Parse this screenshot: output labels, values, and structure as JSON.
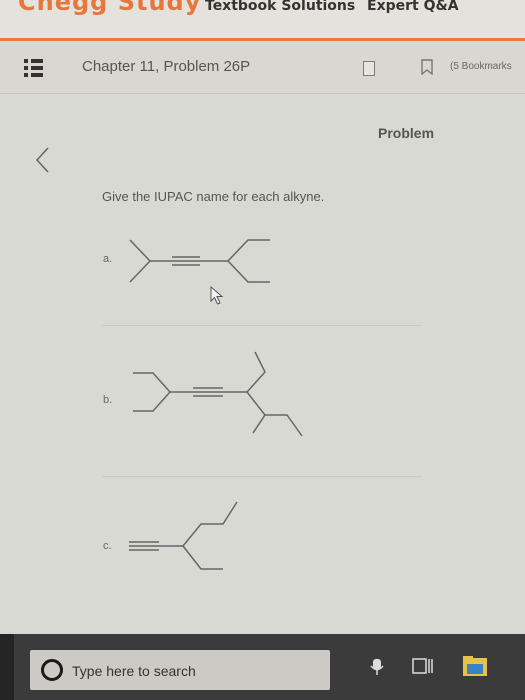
{
  "topnav": {
    "brand": "Chegg Study",
    "links": [
      "Textbook Solutions",
      "Expert Q&A"
    ]
  },
  "header": {
    "chapter_title": "Chapter 11, Problem 26P",
    "bookmarks_label": "(5 Bookmarks"
  },
  "main": {
    "problem_label": "Problem",
    "question": "Give the IUPAC name for each alkyne.",
    "parts": [
      "a.",
      "b.",
      "c."
    ]
  },
  "taskbar": {
    "search_placeholder": "Type here to search"
  },
  "colors": {
    "accent_orange": "#e47b3f",
    "brand_orange": "#e8753a",
    "taskbar": "#3b3b3c"
  },
  "icons": [
    "menu-icon",
    "bookmark-icon",
    "back-chevron-icon",
    "cursor-icon",
    "cortana-circle-icon",
    "task-view-icon",
    "file-explorer-icon"
  ]
}
